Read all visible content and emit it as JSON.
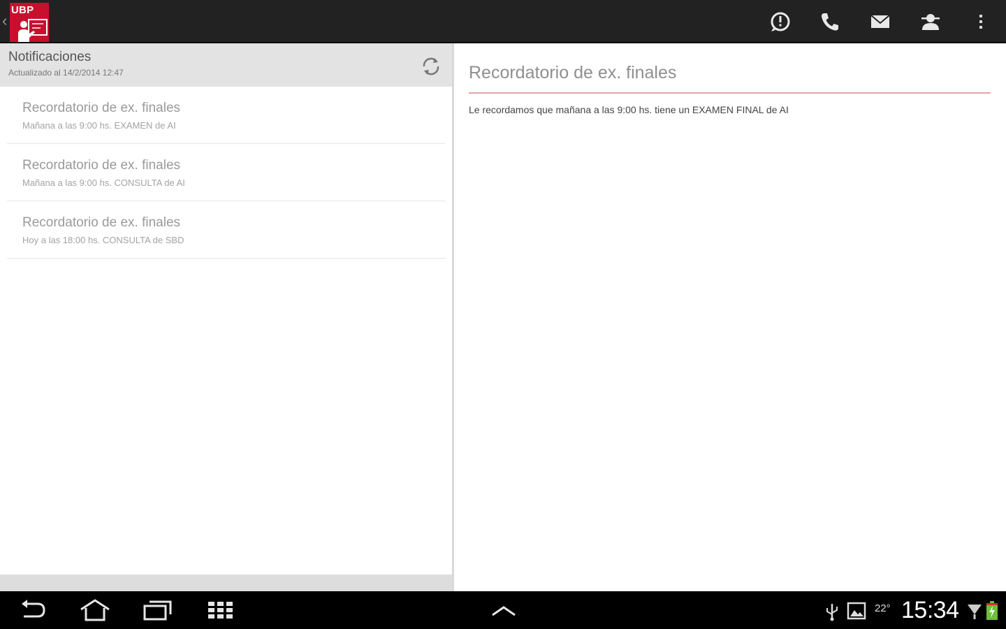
{
  "app": {
    "logo_text": "UBP"
  },
  "action_bar": {
    "icons": [
      "alert-icon",
      "phone-icon",
      "mail-icon",
      "contact-icon",
      "overflow-menu-icon"
    ]
  },
  "notifications": {
    "title": "Notificaciones",
    "updated": "Actualizado al 14/2/2014 12:47",
    "items": [
      {
        "title": "Recordatorio de ex. finales",
        "subtitle": "Mañana a las 9:00 hs. EXAMEN de AI"
      },
      {
        "title": "Recordatorio de ex. finales",
        "subtitle": "Mañana a las 9:00 hs. CONSULTA de AI"
      },
      {
        "title": "Recordatorio de ex. finales",
        "subtitle": "Hoy a las 18:00 hs. CONSULTA de SBD"
      }
    ]
  },
  "detail": {
    "title": "Recordatorio de ex. finales",
    "body": "Le recordamos que mañana a las 9:00 hs. tiene un EXAMEN FINAL de AI"
  },
  "system_bar": {
    "time": "15:34",
    "temperature": "22°"
  },
  "colors": {
    "brand": "#c8102e",
    "action_bar": "#222222",
    "accent_line": "#e0a3ab"
  }
}
